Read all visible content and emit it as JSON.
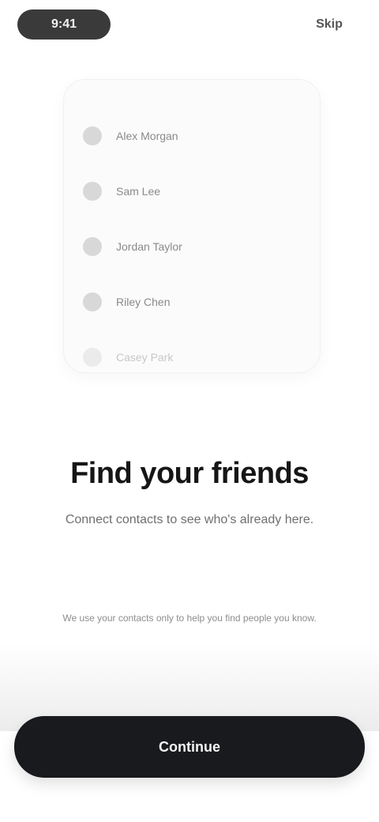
{
  "status_bar": {
    "time": "9:41",
    "action": "Skip"
  },
  "preview": {
    "contacts": [
      {
        "name": "Alex Morgan"
      },
      {
        "name": "Sam Lee"
      },
      {
        "name": "Jordan Taylor"
      },
      {
        "name": "Riley Chen"
      },
      {
        "name": "Casey Park"
      }
    ]
  },
  "content": {
    "headline": "Find your friends",
    "description": "Connect contacts to see who's already here.",
    "privacy_note": "We use your contacts only to help you find people you know."
  },
  "actions": {
    "continue_label": "Continue"
  }
}
